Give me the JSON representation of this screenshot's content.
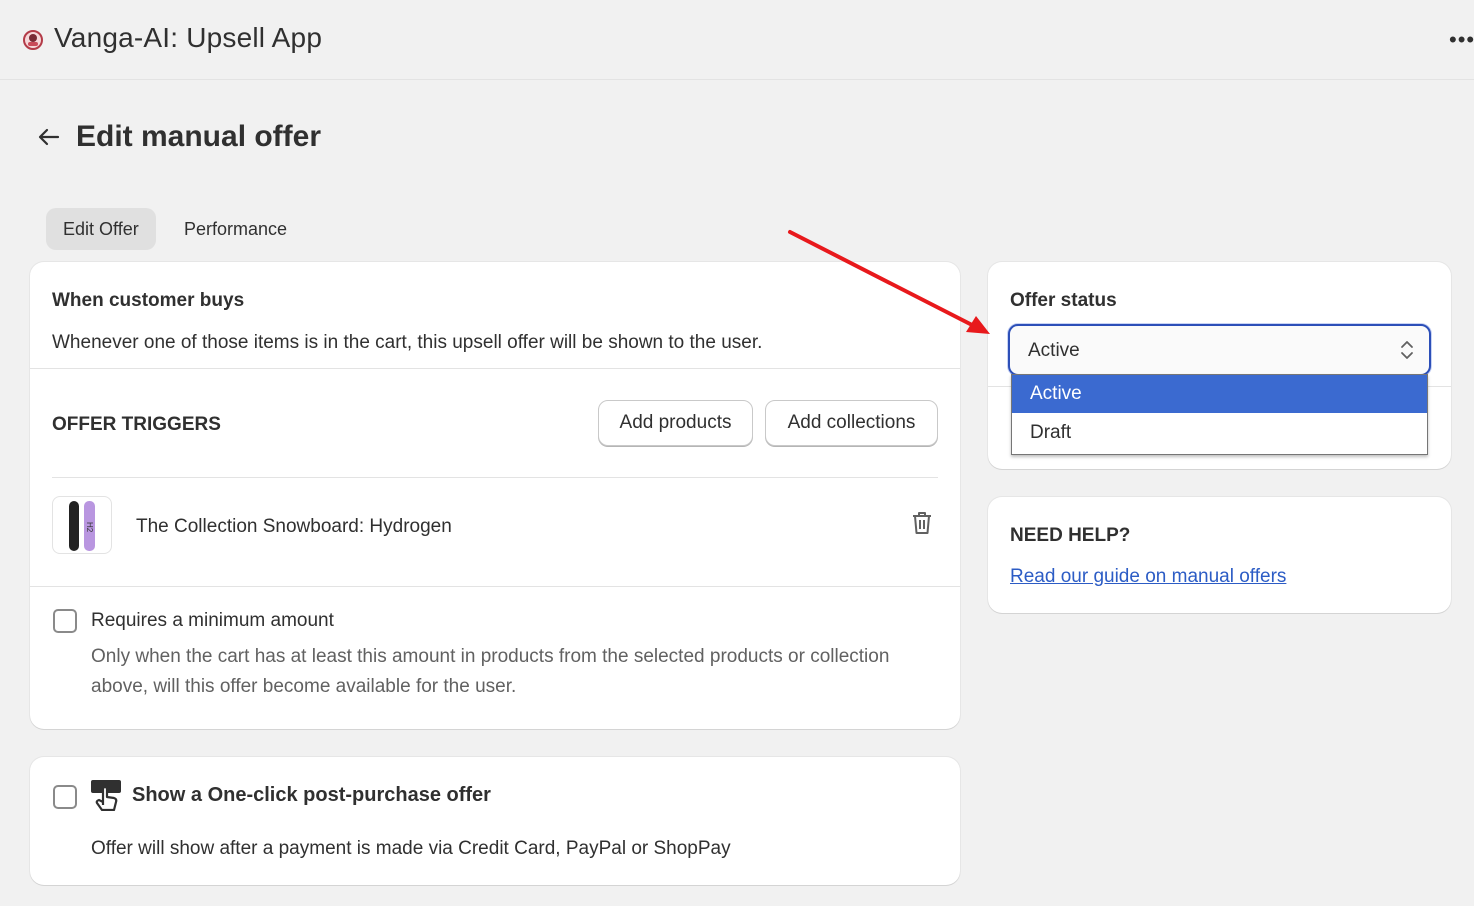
{
  "app": {
    "title": "Vanga-AI: Upsell App",
    "logo_icon": "vanga-logo-icon",
    "more_icon": "more-horizontal-icon",
    "more_glyph": "•••"
  },
  "page": {
    "title": "Edit manual offer",
    "back_icon": "arrow-left-icon"
  },
  "tabs": [
    {
      "label": "Edit Offer",
      "active": true
    },
    {
      "label": "Performance",
      "active": false
    }
  ],
  "when_customer_buys": {
    "heading": "When customer buys",
    "description": "Whenever one of those items is in the cart, this upsell offer will be shown to the user."
  },
  "offer_triggers": {
    "heading": "OFFER TRIGGERS",
    "add_products_label": "Add products",
    "add_collections_label": "Add collections",
    "items": [
      {
        "name": "The Collection Snowboard: Hydrogen",
        "thumb_icon": "snowboard-thumbnail",
        "delete_icon": "trash-icon"
      }
    ]
  },
  "minimum_amount": {
    "checked": false,
    "label": "Requires a minimum amount",
    "help_line1": "Only when the cart has at least this amount in products from the selected products or collection",
    "help_line2": "above, will this offer become available for the user."
  },
  "post_purchase": {
    "checked": false,
    "icon": "one-click-tap-icon",
    "label": "Show a One-click post-purchase offer",
    "help": "Offer will show after a payment is made via Credit Card, PayPal or ShopPay"
  },
  "offer_status": {
    "heading": "Offer status",
    "selected": "Active",
    "options": [
      "Active",
      "Draft"
    ],
    "chevron_icon": "select-chevron-icon"
  },
  "help": {
    "heading": "NEED HELP?",
    "link_text": "Read our guide on manual offers"
  },
  "colors": {
    "background": "#f1f1f1",
    "card": "#ffffff",
    "link": "#2c5cc5",
    "select_focus": "#2c4fb8",
    "option_highlight": "#3b6ad0",
    "annotation_arrow": "#e8191c"
  }
}
